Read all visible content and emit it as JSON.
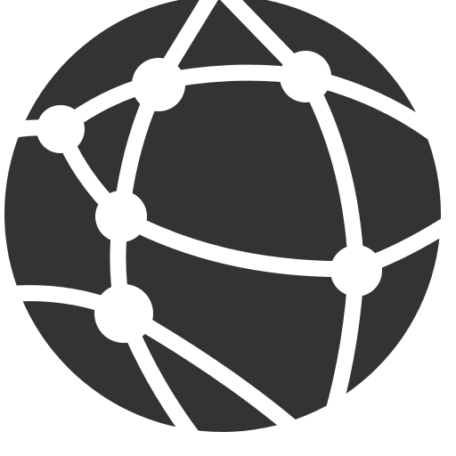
{
  "icon": {
    "name": "network-globe-icon",
    "fill_color": "#333333",
    "line_color": "#ffffff",
    "background_color": "#ffffff"
  }
}
